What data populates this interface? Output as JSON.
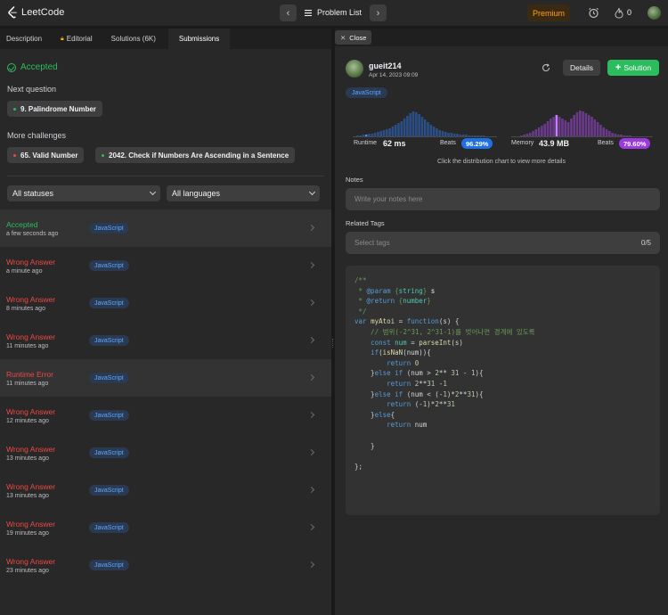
{
  "app": {
    "brand": "LeetCode",
    "problem_list_label": "Problem List",
    "premium_label": "Premium",
    "streak_count": "0",
    "icons": {
      "prev": "chevron-left-icon",
      "next": "chevron-right-icon",
      "list": "list-icon",
      "timer": "alarm-clock-icon",
      "streak": "flame-icon"
    }
  },
  "left": {
    "tabs": [
      {
        "label": "Description"
      },
      {
        "label": "Editorial"
      },
      {
        "label": "Solutions (6K)"
      },
      {
        "label": "Submissions"
      }
    ],
    "active_tab": "Submissions",
    "result": "Accepted",
    "next_question_label": "Next question",
    "next_question": "9. Palindrome Number",
    "more_challenges_label": "More challenges",
    "challenges": [
      "65. Valid Number",
      "2042. Check if Numbers Are Ascending in a Sentence"
    ],
    "filters": {
      "status": "All statuses",
      "language": "All languages"
    },
    "submissions": [
      {
        "status": "Accepted",
        "time": "a few seconds ago",
        "lang": "JavaScript"
      },
      {
        "status": "Wrong Answer",
        "time": "a minute ago",
        "lang": "JavaScript"
      },
      {
        "status": "Wrong Answer",
        "time": "8 minutes ago",
        "lang": "JavaScript"
      },
      {
        "status": "Wrong Answer",
        "time": "11 minutes ago",
        "lang": "JavaScript"
      },
      {
        "status": "Runtime Error",
        "time": "11 minutes ago",
        "lang": "JavaScript"
      },
      {
        "status": "Wrong Answer",
        "time": "12 minutes ago",
        "lang": "JavaScript"
      },
      {
        "status": "Wrong Answer",
        "time": "13 minutes ago",
        "lang": "JavaScript"
      },
      {
        "status": "Wrong Answer",
        "time": "13 minutes ago",
        "lang": "JavaScript"
      },
      {
        "status": "Wrong Answer",
        "time": "19 minutes ago",
        "lang": "JavaScript"
      },
      {
        "status": "Wrong Answer",
        "time": "23 minutes ago",
        "lang": "JavaScript"
      }
    ]
  },
  "right": {
    "close_label": "Close",
    "user": "gueit214",
    "date": "Apr 14, 2023 09:09",
    "details_label": "Details",
    "solution_label": "Solution",
    "language": "JavaScript",
    "runtime": {
      "label": "Runtime",
      "value": "62 ms",
      "beats_label": "Beats",
      "beats": "96.29%"
    },
    "memory": {
      "label": "Memory",
      "value": "43.9 MB",
      "beats_label": "Beats",
      "beats": "79.60%"
    },
    "chart_hint": "Click the distribution chart to view more details",
    "notes_label": "Notes",
    "notes_placeholder": "Write your notes here",
    "tags_label": "Related Tags",
    "tags_placeholder": "Select tags",
    "tags_count": "0/5",
    "colors": {
      "accepted": "#2cbb5d",
      "wrong": "#ef4743",
      "runtime_accent": "#3f8cff",
      "memory_accent": "#a855f7",
      "premium": "#ffa116"
    },
    "code": [
      "/**",
      " * @param {string} s",
      " * @return {number}",
      " */",
      "var myAtoi = function(s) {",
      "    // 범위(-2^31, 2^31-1)를 벗어나면 경계에 있도록",
      "    const num = parseInt(s)",
      "    if(isNaN(num)){",
      "        return 0",
      "    }else if (num > 2** 31 - 1){",
      "        return 2**31 -1",
      "    }else if (num < (-1)*2**31){",
      "        return (-1)*2**31",
      "    }else{",
      "        return num",
      "",
      "    }",
      "",
      "};"
    ]
  }
}
